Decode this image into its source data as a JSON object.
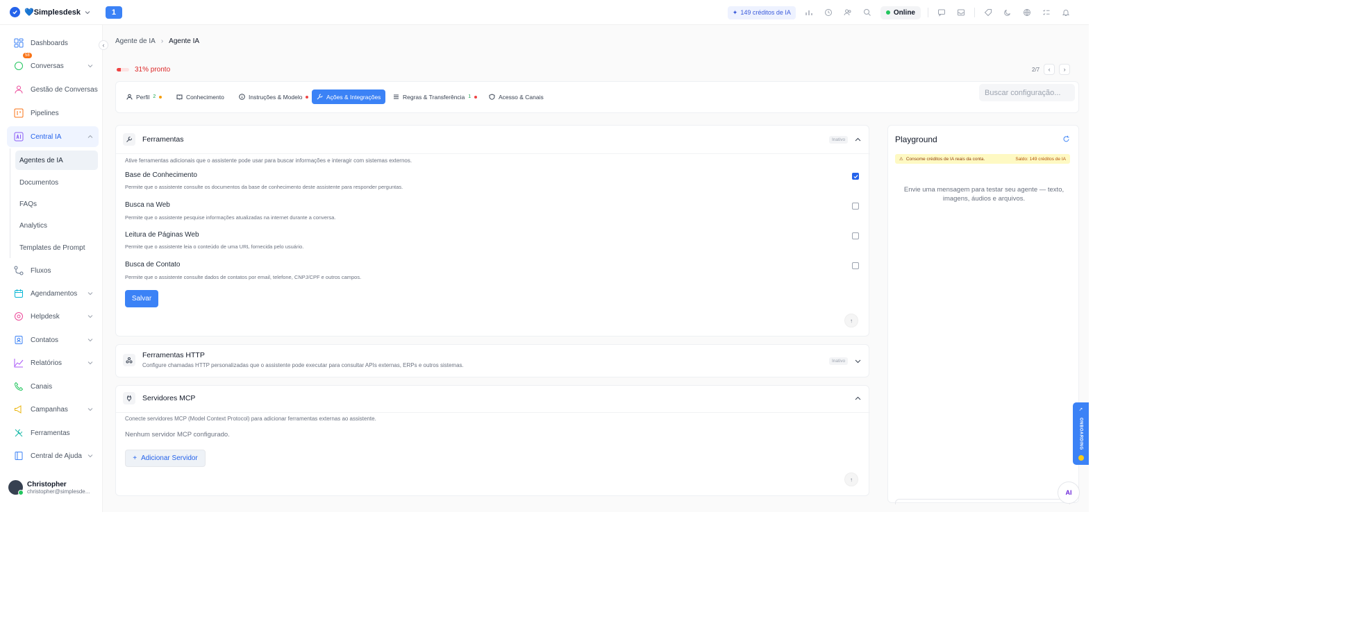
{
  "header": {
    "brand": "💙Simplesdesk",
    "badge": "1",
    "credits": "149 créditos de IA",
    "online": "Online"
  },
  "sidebar": {
    "items": [
      {
        "key": "dashboards",
        "label": "Dashboards"
      },
      {
        "key": "conversas",
        "label": "Conversas",
        "badge": "58"
      },
      {
        "key": "gestao",
        "label": "Gestão de Conversas"
      },
      {
        "key": "pipelines",
        "label": "Pipelines"
      },
      {
        "key": "central-ia",
        "label": "Central IA"
      },
      {
        "key": "fluxos",
        "label": "Fluxos"
      },
      {
        "key": "agendamentos",
        "label": "Agendamentos"
      },
      {
        "key": "helpdesk",
        "label": "Helpdesk"
      },
      {
        "key": "contatos",
        "label": "Contatos"
      },
      {
        "key": "relatorios",
        "label": "Relatórios"
      },
      {
        "key": "canais",
        "label": "Canais"
      },
      {
        "key": "campanhas",
        "label": "Campanhas"
      },
      {
        "key": "ferramentas",
        "label": "Ferramentas"
      },
      {
        "key": "central-ajuda",
        "label": "Central de Ajuda"
      }
    ],
    "sub_items": [
      {
        "label": "Agentes de IA"
      },
      {
        "label": "Documentos"
      },
      {
        "label": "FAQs"
      },
      {
        "label": "Analytics"
      },
      {
        "label": "Templates de Prompt"
      }
    ],
    "user": {
      "name": "Christopher",
      "email": "christopher@simplesde..."
    }
  },
  "breadcrumb": {
    "parent": "Agente de IA",
    "current": "Agente IA"
  },
  "progress": {
    "fraction": 0.31,
    "label": "31% pronto"
  },
  "pager": {
    "label": "2/7"
  },
  "tabs": [
    {
      "label": "Perfil",
      "count": "2",
      "dot": "#f59e0b"
    },
    {
      "label": "Conhecimento"
    },
    {
      "label": "Instruções & Modelo",
      "dot": "#ef4444"
    },
    {
      "label": "Ações & Integrações",
      "active": true
    },
    {
      "label": "Regras & Transferência",
      "count": "1",
      "dot": "#ef4444"
    },
    {
      "label": "Acesso & Canais"
    }
  ],
  "search": {
    "placeholder": "Buscar configuração..."
  },
  "tools_card": {
    "title": "Ferramentas",
    "status": "Inativo",
    "description": "Ative ferramentas adicionais que o assistente pode usar para buscar informações e interagir com sistemas externos.",
    "items": [
      {
        "name": "Base de Conhecimento",
        "desc": "Permite que o assistente consulte os documentos da base de conhecimento deste assistente para responder perguntas.",
        "checked": true
      },
      {
        "name": "Busca na Web",
        "desc": "Permite que o assistente pesquise informações atualizadas na internet durante a conversa.",
        "checked": false
      },
      {
        "name": "Leitura de Páginas Web",
        "desc": "Permite que o assistente leia o conteúdo de uma URL fornecida pelo usuário.",
        "checked": false
      },
      {
        "name": "Busca de Contato",
        "desc": "Permite que o assistente consulte dados de contatos por email, telefone, CNPJ/CPF e outros campos.",
        "checked": false
      }
    ],
    "save_label": "Salvar"
  },
  "http_card": {
    "title": "Ferramentas HTTP",
    "description": "Configure chamadas HTTP personalizadas que o assistente pode executar para consultar APIs externas, ERPs e outros sistemas.",
    "status": "Inativo"
  },
  "mcp_card": {
    "title": "Servidores MCP",
    "description": "Conecte servidores MCP (Model Context Protocol) para adicionar ferramentas externas ao assistente.",
    "empty": "Nenhum servidor MCP configurado.",
    "add_label": "Adicionar Servidor"
  },
  "playground": {
    "title": "Playground",
    "warning": "Consome créditos de IA reais da conta.",
    "balance": "Saldo: 149 créditos de IA",
    "empty": "Envie uma mensagem para testar seu agente — texto, imagens, áudios e arquivos."
  },
  "fab": {
    "label": "AI"
  },
  "side_tab": {
    "label": "ONBOARDING"
  },
  "colors": {
    "primary": "#3b82f6",
    "danger": "#ef4444",
    "success": "#22c55e",
    "warning_bg": "#fef9c3"
  }
}
